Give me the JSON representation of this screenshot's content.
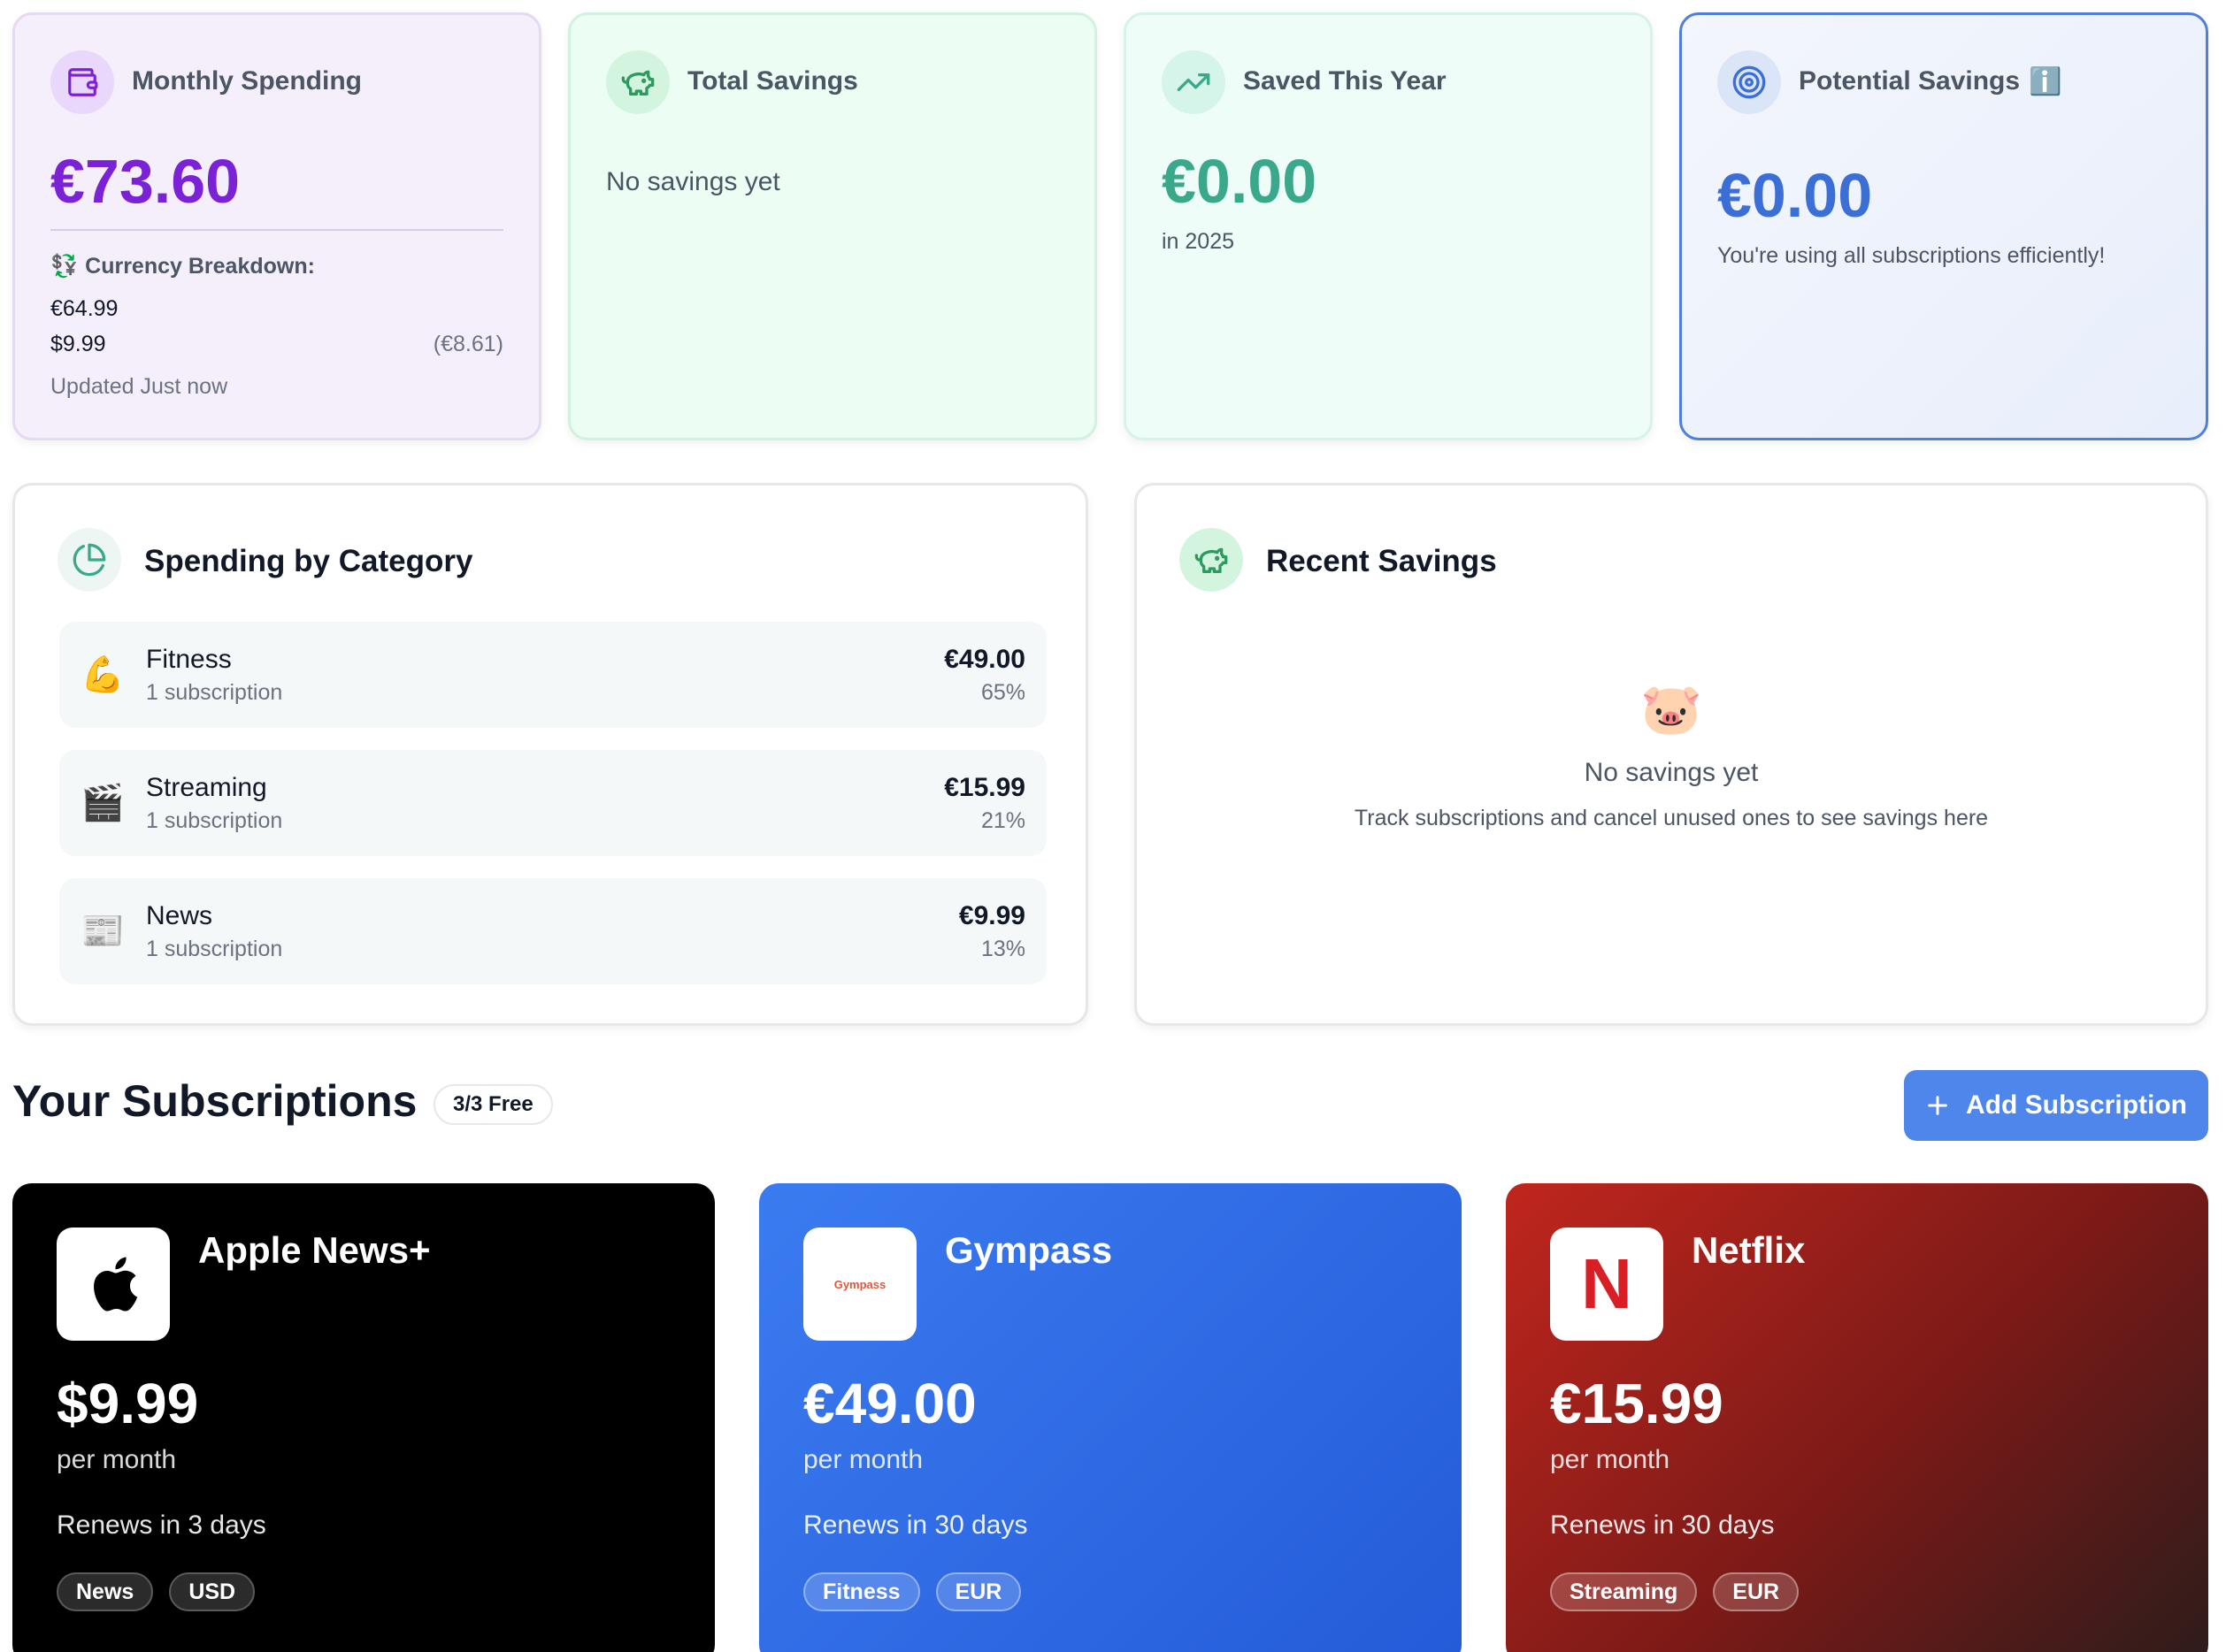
{
  "stats": {
    "monthly": {
      "title": "Monthly Spending",
      "value": "€73.60",
      "breakdown_label": "Currency Breakdown:",
      "breakdown_icon": "💱",
      "line1": "€64.99",
      "line2": "$9.99",
      "line2_converted": "(€8.61)",
      "updated": "Updated Just now",
      "accent": "#7b22d6"
    },
    "total": {
      "title": "Total Savings",
      "empty": "No savings yet"
    },
    "year": {
      "title": "Saved This Year",
      "value": "€0.00",
      "sub": "in 2025",
      "accent": "#3aa88a"
    },
    "potential": {
      "title": "Potential Savings",
      "info_icon": "ℹ️",
      "value": "€0.00",
      "sub": "You're using all subscriptions efficiently!",
      "accent": "#3b6fd6"
    }
  },
  "category_panel": {
    "title": "Spending by Category",
    "rows": [
      {
        "emoji": "💪",
        "name": "Fitness",
        "sub": "1 subscription",
        "amount": "€49.00",
        "pct": "65%"
      },
      {
        "emoji": "🎬",
        "name": "Streaming",
        "sub": "1 subscription",
        "amount": "€15.99",
        "pct": "21%"
      },
      {
        "emoji": "📰",
        "name": "News",
        "sub": "1 subscription",
        "amount": "€9.99",
        "pct": "13%"
      }
    ]
  },
  "recent_panel": {
    "title": "Recent Savings",
    "emoji": "🐷",
    "empty_title": "No savings yet",
    "empty_sub": "Track subscriptions and cancel unused ones to see savings here"
  },
  "subscriptions": {
    "title": "Your Subscriptions",
    "badge": "3/3 Free",
    "add_label": "Add Subscription",
    "items": [
      {
        "name": "Apple News+",
        "price": "$9.99",
        "period": "per month",
        "renew": "Renews in 3 days",
        "tags": [
          "News",
          "USD"
        ]
      },
      {
        "name": "Gympass",
        "logo_text": "Gympass",
        "price": "€49.00",
        "period": "per month",
        "renew": "Renews in 30 days",
        "tags": [
          "Fitness",
          "EUR"
        ]
      },
      {
        "name": "Netflix",
        "logo_text": "N",
        "price": "€15.99",
        "period": "per month",
        "renew": "Renews in 30 days",
        "tags": [
          "Streaming",
          "EUR"
        ]
      }
    ]
  }
}
